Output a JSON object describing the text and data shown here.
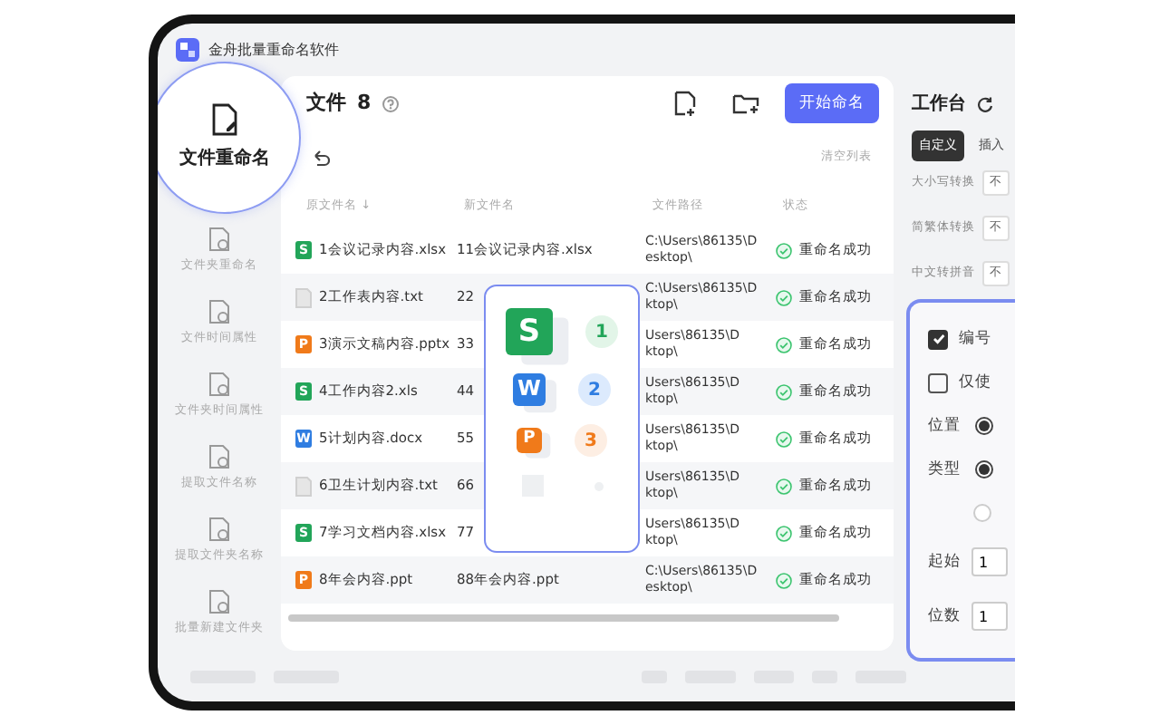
{
  "window": {
    "title": "金舟批量重命名软件"
  },
  "sidebar": {
    "items": [
      {
        "label": "文件重命名",
        "selected": true
      },
      {
        "label": "文件夹重命名",
        "selected": false
      },
      {
        "label": "文件时间属性",
        "selected": false
      },
      {
        "label": "文件夹时间属性",
        "selected": false
      },
      {
        "label": "提取文件名称",
        "selected": false
      },
      {
        "label": "提取文件夹名称",
        "selected": false
      },
      {
        "label": "批量新建文件夹",
        "selected": false
      }
    ]
  },
  "files": {
    "title": "文件",
    "count": "8",
    "start_button": "开始命名",
    "clear_link": "清空列表",
    "columns": [
      "原文件名 ↓",
      "新文件名",
      "文件路径",
      "状态"
    ],
    "rows": [
      {
        "kind": "sheet",
        "letter": "S",
        "original": "1会议记录内容.xlsx",
        "new_name": "11会议记录内容.xlsx",
        "path": [
          "C:\\Users\\86135\\D",
          "esktop\\"
        ],
        "status": "重命名成功"
      },
      {
        "kind": "text",
        "original": "2工作表内容.txt",
        "new_name": "22",
        "path": [
          "C:\\Users\\86135\\D",
          "ktop\\"
        ],
        "status": "重命名成功"
      },
      {
        "kind": "slide",
        "letter": "P",
        "original": "3演示文稿内容.pptx",
        "new_name": "33",
        "path": [
          "Users\\86135\\D",
          "ktop\\"
        ],
        "status": "重命名成功"
      },
      {
        "kind": "sheet",
        "letter": "S",
        "original": "4工作内容2.xls",
        "new_name": "44",
        "path": [
          "Users\\86135\\D",
          "ktop\\"
        ],
        "status": "重命名成功"
      },
      {
        "kind": "doc",
        "letter": "W",
        "original": "5计划内容.docx",
        "new_name": "55",
        "path": [
          "Users\\86135\\D",
          "ktop\\"
        ],
        "status": "重命名成功"
      },
      {
        "kind": "text",
        "original": "6卫生计划内容.txt",
        "new_name": "66",
        "path": [
          "Users\\86135\\D",
          "ktop\\"
        ],
        "status": "重命名成功"
      },
      {
        "kind": "sheet",
        "letter": "S",
        "original": "7学习文档内容.xlsx",
        "new_name": "77",
        "path": [
          "Users\\86135\\D",
          "ktop\\"
        ],
        "status": "重命名成功"
      },
      {
        "kind": "slide",
        "letter": "P",
        "original": "8年会内容.ppt",
        "new_name": "88年会内容.ppt",
        "path": [
          "C:\\Users\\86135\\D",
          "esktop\\"
        ],
        "status": "重命名成功"
      }
    ]
  },
  "popup": {
    "items": [
      {
        "kind": "sheet",
        "letter": "S",
        "number": "1"
      },
      {
        "kind": "doc",
        "letter": "W",
        "number": "2"
      },
      {
        "kind": "slide",
        "letter": "P",
        "number": "3"
      }
    ]
  },
  "workbench": {
    "title": "工作台",
    "tabs": [
      {
        "label": "自定义",
        "selected": true
      },
      {
        "label": "插入",
        "selected": false
      }
    ],
    "options": [
      {
        "label": "大小写转换",
        "value": "不"
      },
      {
        "label": "简繁体转换",
        "value": "不"
      },
      {
        "label": "中文转拼音",
        "value": "不"
      }
    ]
  },
  "number_settings": {
    "rows": [
      {
        "kind": "checkbox",
        "label": "编号",
        "checked": true
      },
      {
        "kind": "checkbox",
        "label": "仅使",
        "checked": false
      },
      {
        "kind": "radio",
        "label": "位置",
        "selected": true
      },
      {
        "kind": "radio",
        "label": "类型",
        "selected": true
      },
      {
        "kind": "radio",
        "selected": false
      },
      {
        "kind": "input",
        "label": "起始",
        "value": "1"
      },
      {
        "kind": "input",
        "label": "位数",
        "value": "1"
      }
    ]
  }
}
